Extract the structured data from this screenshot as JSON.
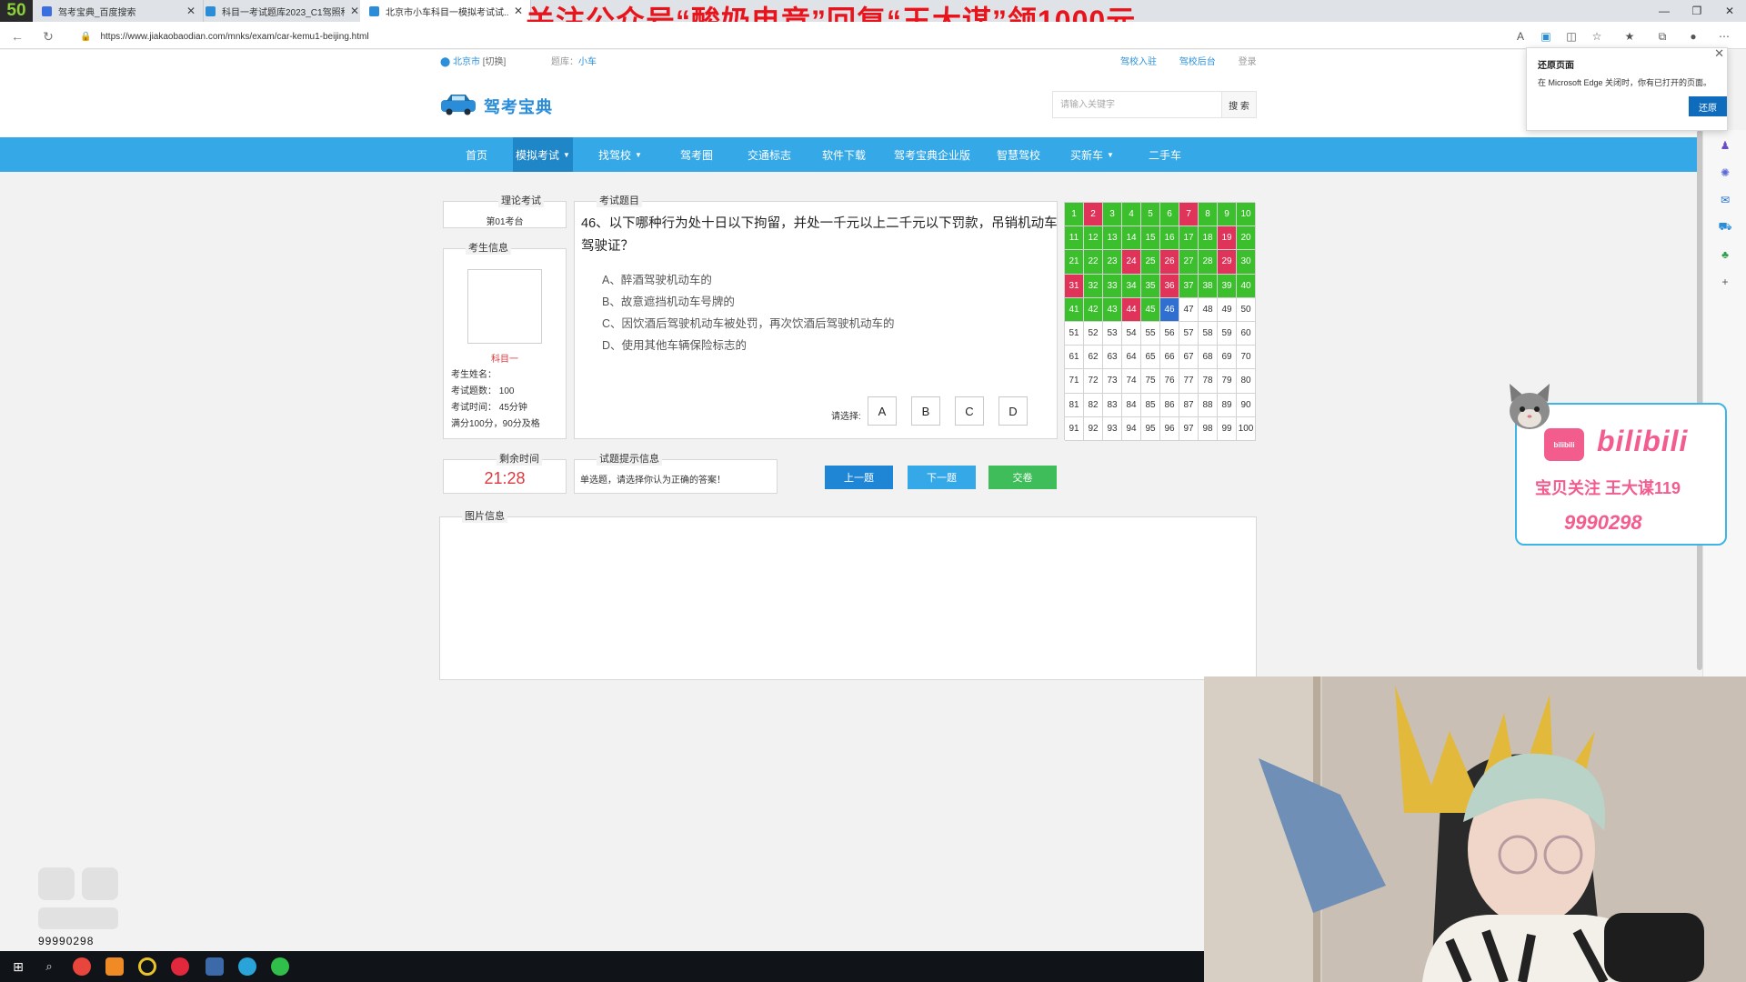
{
  "browser": {
    "tab_counter": "50",
    "tabs": [
      {
        "title": "驾考宝典_百度搜索",
        "fav_color": "#3b6fe0"
      },
      {
        "title": "科目一考试题库2023_C1驾照科目...",
        "fav_color": "#2b8dd8"
      },
      {
        "title": "北京市小车科目一模拟考试试...",
        "fav_color": "#2b8dd8"
      }
    ],
    "promo_banner": "关注公众号“酸奶电竞”回复“王大谋”领1000元",
    "url": "https://www.jiakaobaodian.com/mnks/exam/car-kemu1-beijing.html"
  },
  "site": {
    "location_city": "北京市",
    "location_switch": "[切换]",
    "library_label": "题库：",
    "library_value": "小车",
    "top_links": [
      "驾校入驻",
      "驾校后台",
      "登录"
    ],
    "logo_text": "驾考宝典",
    "search_placeholder": "请输入关键字",
    "search_button": "搜 索",
    "nav": [
      {
        "label": "首页",
        "active": false,
        "dropdown": false
      },
      {
        "label": "模拟考试",
        "active": true,
        "dropdown": true
      },
      {
        "label": "找驾校",
        "active": false,
        "dropdown": true
      },
      {
        "label": "驾考圈",
        "active": false,
        "dropdown": false
      },
      {
        "label": "交通标志",
        "active": false,
        "dropdown": false
      },
      {
        "label": "软件下载",
        "active": false,
        "dropdown": false
      },
      {
        "label": "驾考宝典企业版",
        "active": false,
        "dropdown": false
      },
      {
        "label": "智慧驾校",
        "active": false,
        "dropdown": false
      },
      {
        "label": "买新车",
        "active": false,
        "dropdown": true
      },
      {
        "label": "二手车",
        "active": false,
        "dropdown": false
      }
    ]
  },
  "exam": {
    "theory_legend": "理论考试",
    "station": "第01考台",
    "candidate_legend": "考生信息",
    "subject": "科目一",
    "candidate_name": "考生姓名：",
    "question_count": "考试题数：  100",
    "exam_time": "考试时间：  45分钟",
    "passing": "满分100分，90分及格",
    "question_legend": "考试题目",
    "question": "46、以下哪种行为处十日以下拘留，并处一千元以上二千元以下罚款，吊销机动车驾驶证？",
    "options": [
      "A、醉酒驾驶机动车的",
      "B、故意遮挡机动车号牌的",
      "C、因饮酒后驾驶机动车被处罚，再次饮酒后驾驶机动车的",
      "D、使用其他车辆保险标志的"
    ],
    "choose_label": "请选择:",
    "choices": [
      "A",
      "B",
      "C",
      "D"
    ],
    "remaining_legend": "剩余时间",
    "remaining_time": "21:28",
    "hint_legend": "试题提示信息",
    "hint_text": "单选题，请选择你认为正确的答案！",
    "prev_button": "上一题",
    "next_button": "下一题",
    "submit_button": "交卷",
    "image_legend": "图片信息",
    "colors": {
      "correct": "#3bbf2c",
      "wrong": "#e0335a",
      "current": "#2f6fd0"
    },
    "answer_sheet": {
      "total": 100,
      "wrong": [
        2,
        7,
        19,
        24,
        26,
        29,
        31,
        36,
        44
      ],
      "answered_through": 45,
      "current": 46
    }
  },
  "edge_popup": {
    "title": "还原页面",
    "message": "在 Microsoft Edge 关闭时，你有已打开的页面。",
    "button": "还原"
  },
  "overlay": {
    "bili_tv": "bilibili",
    "bili_logo": "bilibili",
    "bili_subtitle": "宝贝关注 王大谋119",
    "bili_number": "9990298",
    "watermark_number": "99990298"
  }
}
